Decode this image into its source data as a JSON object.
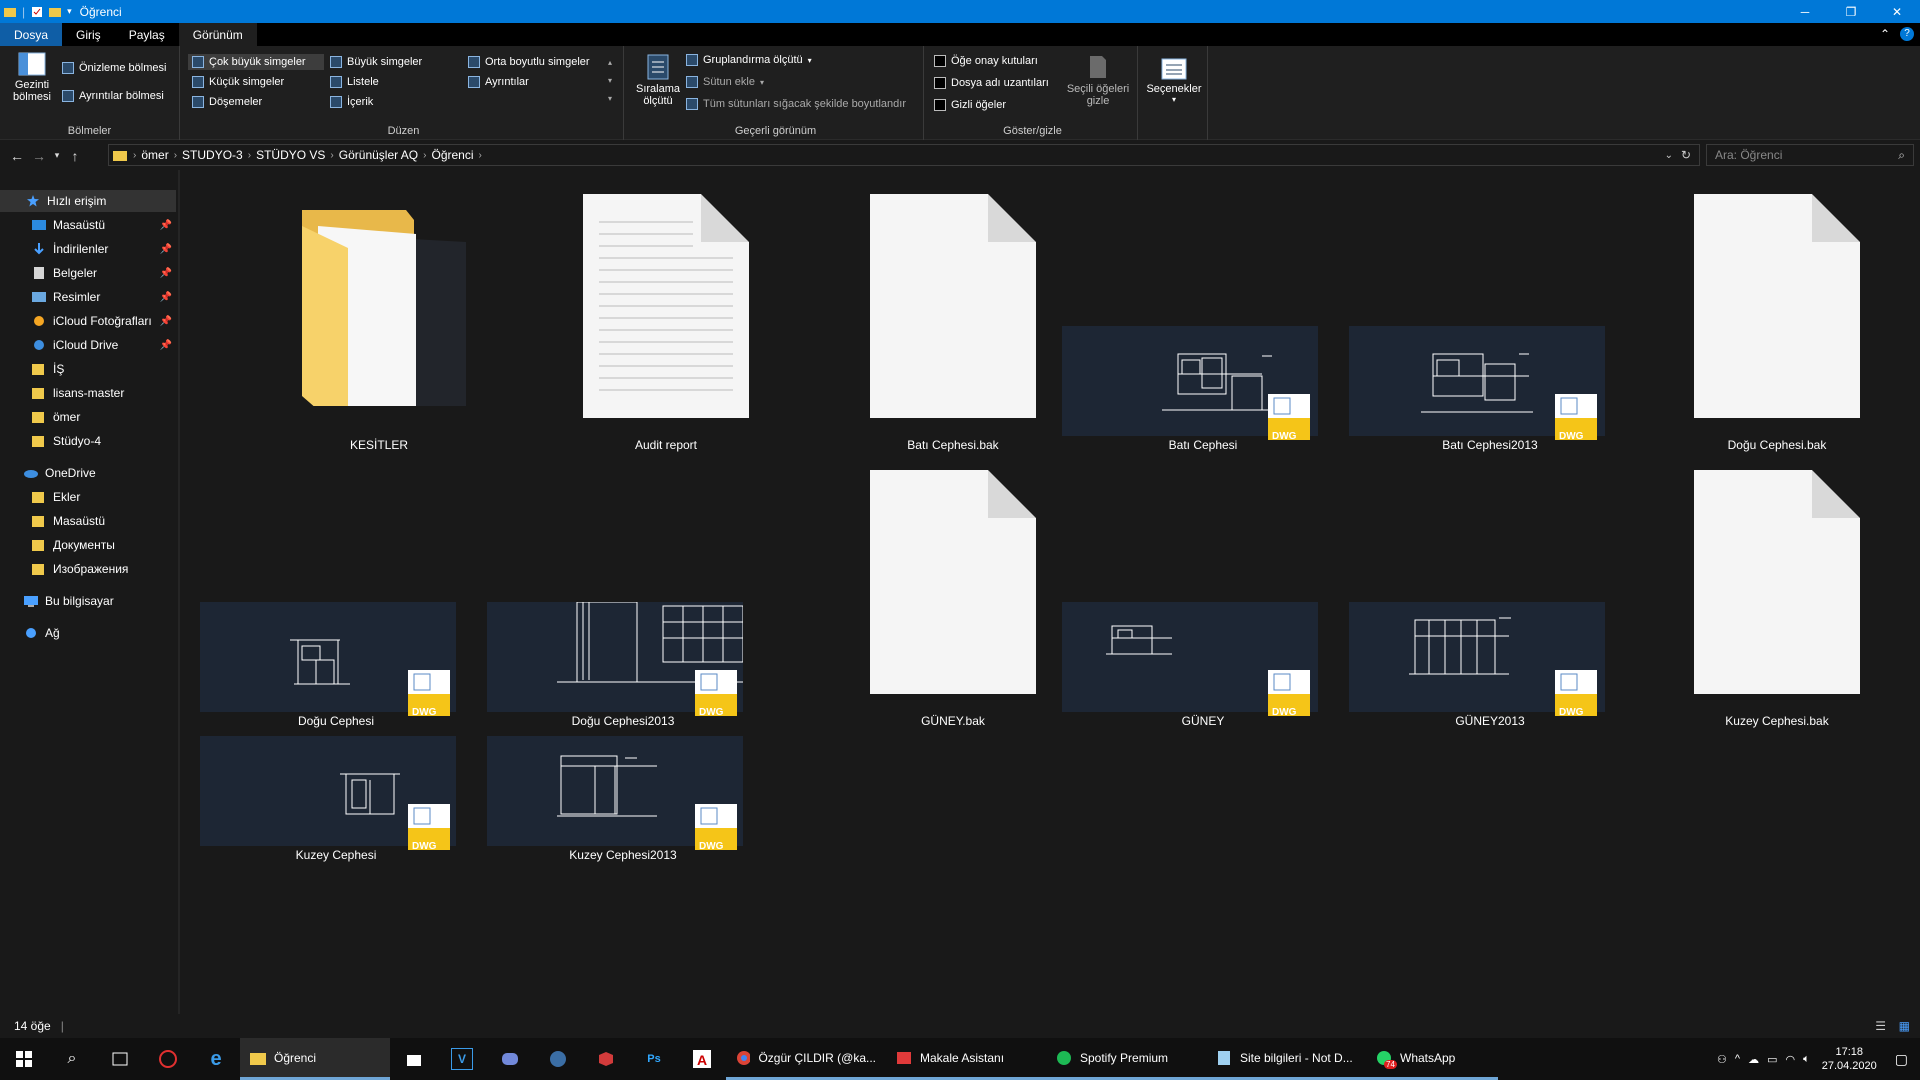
{
  "window": {
    "title": "Öğrenci",
    "minimize": "─",
    "maximize": "❐",
    "close": "✕"
  },
  "ribbon_tabs": [
    "Dosya",
    "Giriş",
    "Paylaş",
    "Görünüm"
  ],
  "ribbon": {
    "panes": {
      "nav_pane": "Gezinti bölmesi",
      "preview_pane": "Önizleme bölmesi",
      "details_pane": "Ayrıntılar bölmesi",
      "label": "Bölmeler"
    },
    "layout": {
      "xl": "Çok büyük simgeler",
      "large": "Büyük simgeler",
      "medium": "Orta boyutlu simgeler",
      "small": "Küçük simgeler",
      "list": "Listele",
      "details": "Ayrıntılar",
      "tiles": "Döşemeler",
      "content": "İçerik",
      "label": "Düzen"
    },
    "current_view": {
      "sort": "Sıralama ölçütü",
      "group": "Gruplandırma ölçütü",
      "add_col": "Sütun ekle",
      "fit_cols": "Tüm sütunları sığacak şekilde boyutlandır",
      "label": "Geçerli görünüm"
    },
    "show_hide": {
      "item_cb": "Öğe onay kutuları",
      "ext": "Dosya adı uzantıları",
      "hidden": "Gizli öğeler",
      "hide_selected": "Seçili öğeleri gizle",
      "label": "Göster/gizle"
    },
    "options": "Seçenekler"
  },
  "breadcrumb": [
    "ömer",
    "STUDYO-3",
    "STÜDYO VS",
    "Görünüşler AQ",
    "Öğrenci"
  ],
  "search_placeholder": "Ara: Öğrenci",
  "nav": {
    "quick_access": "Hızlı erişim",
    "quick_items": [
      "Masaüstü",
      "İndirilenler",
      "Belgeler",
      "Resimler",
      "iCloud Fotoğrafları",
      "iCloud Drive",
      "İŞ",
      "lisans-master",
      "ömer",
      "Stüdyo-4"
    ],
    "onedrive": "OneDrive",
    "onedrive_items": [
      "Ekler",
      "Masaüstü",
      "Документы",
      "Изображения"
    ],
    "this_pc": "Bu bilgisayar",
    "network": "Ağ"
  },
  "files": [
    "KESİTLER",
    "Audit report",
    "Batı Cephesi.bak",
    "Batı Cephesi",
    "Batı Cephesi2013",
    "Doğu Cephesi.bak",
    "GÜNEY.bak",
    "Doğu Cephesi",
    "Doğu Cephesi2013",
    "GÜNEY",
    "GÜNEY2013",
    "Kuzey Cephesi.bak",
    "Kuzey Cephesi",
    "Kuzey Cephesi2013"
  ],
  "dwg_badge": "DWG",
  "status": {
    "count": "14 öğe"
  },
  "taskbar": {
    "apps": [
      "Öğrenci",
      "Özgür ÇILDIR (@ka...",
      "Makale Asistanı",
      "Spotify Premium",
      "Site bilgileri - Not D...",
      "WhatsApp"
    ],
    "time": "17:18",
    "date": "27.04.2020",
    "whatsapp_badge": "74"
  },
  "colors": {
    "accent": "#0078d7",
    "dwg": "#f5c518"
  }
}
